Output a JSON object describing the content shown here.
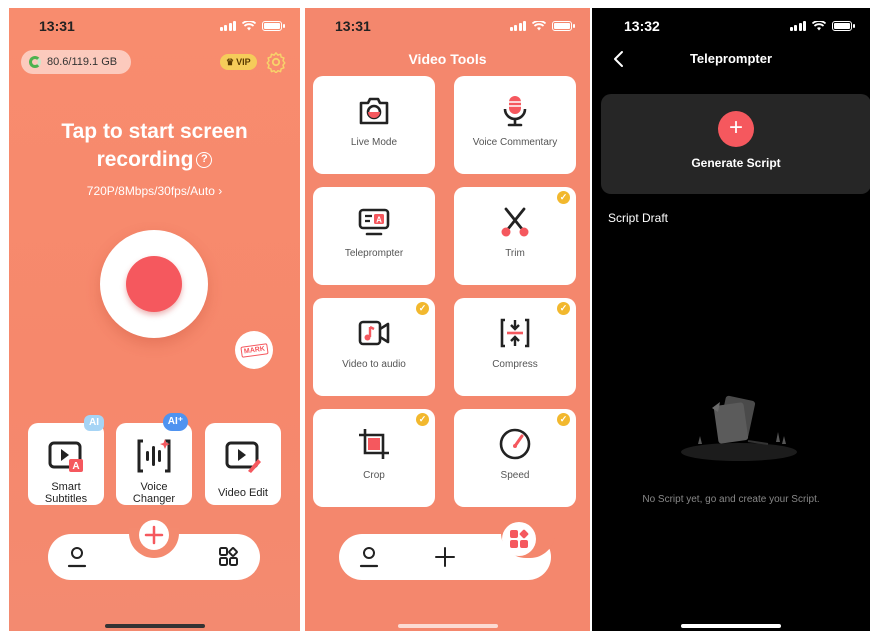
{
  "screen1": {
    "time": "13:31",
    "storage": "80.6/119.1 GB",
    "vip_label": "VIP",
    "headline_line1": "Tap to start screen",
    "headline_line2": "recording",
    "help_symbol": "?",
    "quality": "720P/8Mbps/30fps/Auto",
    "mark_label": "MARK",
    "tools": [
      {
        "label_line1": "Smart",
        "label_line2": "Subtitles",
        "badge": "AI"
      },
      {
        "label_line1": "Voice",
        "label_line2": "Changer",
        "badge": "AI⁺"
      },
      {
        "label_line1": "Video Edit",
        "label_line2": ""
      }
    ]
  },
  "screen2": {
    "time": "13:31",
    "title": "Video Tools",
    "cards": [
      {
        "label": "Live Mode",
        "icon": "camera-icon",
        "badge": false
      },
      {
        "label": "Voice Commentary",
        "icon": "microphone-icon",
        "badge": false
      },
      {
        "label": "Teleprompter",
        "icon": "teleprompter-icon",
        "badge": false
      },
      {
        "label": "Trim",
        "icon": "scissors-icon",
        "badge": true
      },
      {
        "label": "Video to audio",
        "icon": "video-music-icon",
        "badge": true
      },
      {
        "label": "Compress",
        "icon": "compress-icon",
        "badge": true
      },
      {
        "label": "Crop",
        "icon": "crop-icon",
        "badge": true
      },
      {
        "label": "Speed",
        "icon": "speedometer-icon",
        "badge": true
      }
    ]
  },
  "screen3": {
    "time": "13:32",
    "title": "Teleprompter",
    "generate_label": "Generate Script",
    "draft_label": "Script Draft",
    "empty_text": "No Script yet, go and create your Script."
  },
  "colors": {
    "accent": "#f5585e",
    "background_orange": "#f4876d",
    "badge_gold": "#f2b82e",
    "ai_blue": "#4f93f0"
  }
}
